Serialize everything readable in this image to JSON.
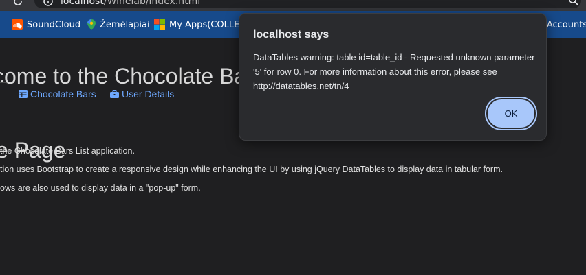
{
  "browser": {
    "url_host": "localhost",
    "url_path": "/Winelab/index.html"
  },
  "bookmarks": [
    {
      "label": "SoundCloud",
      "icon": "soundcloud-icon"
    },
    {
      "label": "Žemėlapiai",
      "icon": "maps-pin-icon"
    },
    {
      "label": "My Apps(COLLEGE",
      "icon": "microsoft-icon"
    },
    {
      "label": "y Accounts",
      "icon": ""
    }
  ],
  "page": {
    "heading": "come to the Chocolate Ba",
    "tabs": [
      {
        "label": "Chocolate Bars",
        "icon": "table-icon"
      },
      {
        "label": "User Details",
        "icon": "briefcase-icon"
      }
    ],
    "section_title": "e Page",
    "paragraphs": [
      "the Chocolate Bars List application.",
      "tion uses Bootstrap to create a responsive design while enhancing the UI by using jQuery DataTables to display data in tabular form.",
      "ows are also used to display data in a \"pop-up\" form."
    ]
  },
  "dialog": {
    "title": "localhost says",
    "message": "DataTables warning: table id=table_id - Requested unknown parameter '5' for row 0. For more information about this error, please see http://datatables.net/tn/4",
    "ok_label": "OK"
  },
  "colors": {
    "bookmark_bar": "#174a8b",
    "page_bg": "#1f1f21",
    "link": "#6ea8fe",
    "ok_button": "#a8c7fa"
  }
}
